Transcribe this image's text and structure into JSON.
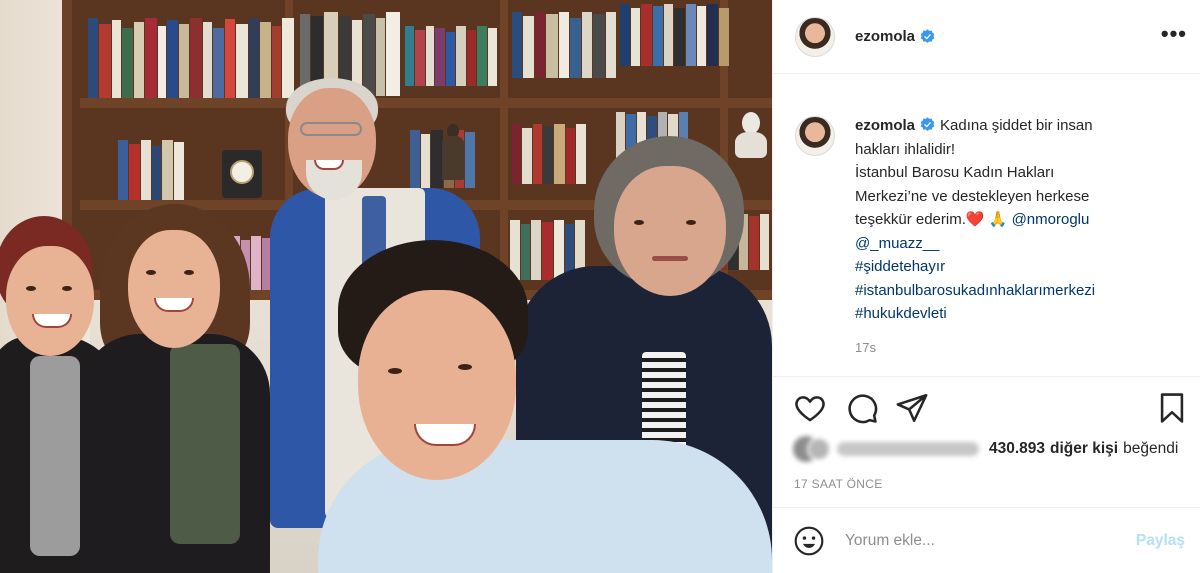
{
  "header": {
    "username": "ezomola",
    "more_label": "•••"
  },
  "caption": {
    "username": "ezomola",
    "line1": "Kadına şiddet bir insan",
    "line2": "hakları ihlalidir!",
    "line3": "İstanbul Barosu Kadın Hakları",
    "line4": "Merkezi’ne ve destekleyen herkese",
    "line5_text": "teşekkür ederim.",
    "line5_emojis": "❤️ 🙏",
    "mention1": "@nmoroglu",
    "mention2": "@_muazz__",
    "hashtags": [
      "#şiddetehayır",
      "#istanbulbarosukadınhaklarımerkezi",
      "#hukukdevleti"
    ],
    "time_ago": "17s"
  },
  "actions": {
    "icons": [
      "heart-icon",
      "comment-icon",
      "share-icon",
      "bookmark-icon"
    ]
  },
  "likes": {
    "count": "430.893",
    "others_label": "diğer kişi",
    "suffix": "beğendi"
  },
  "date": "17 SAAT ÖNCE",
  "comment": {
    "placeholder": "Yorum ekle...",
    "post_label": "Paylaş"
  },
  "colors": {
    "verified": "#3897f0",
    "link": "#00376b",
    "muted": "#8e8e8e",
    "post_disabled": "#b2dffc",
    "heart": "#e0245e"
  }
}
